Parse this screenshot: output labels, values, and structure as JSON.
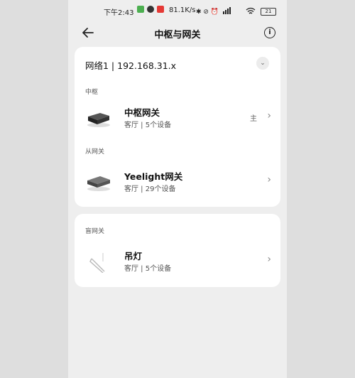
{
  "status": {
    "time": "下午2:43",
    "speed": "81.1K/s",
    "battery": "21"
  },
  "header": {
    "title": "中枢与网关",
    "info_glyph": "i",
    "back_icon": "arrow-left-icon"
  },
  "network": {
    "label": "网络1 | 192.168.31.x",
    "collapse_glyph": "⌄"
  },
  "sections": {
    "hub": "中枢",
    "secondary": "从网关",
    "blind": "盲网关"
  },
  "devices": [
    {
      "name": "中枢网关",
      "sub": "客厅 | 5个设备",
      "tag": "主",
      "chev": "›"
    },
    {
      "name": "Yeelight网关",
      "sub": "客厅 | 29个设备",
      "chev": "›"
    },
    {
      "name": "吊灯",
      "sub": "客厅 | 5个设备",
      "chev": "›"
    }
  ],
  "colors": {
    "card": "#ffffff",
    "background": "#eeeeee"
  }
}
